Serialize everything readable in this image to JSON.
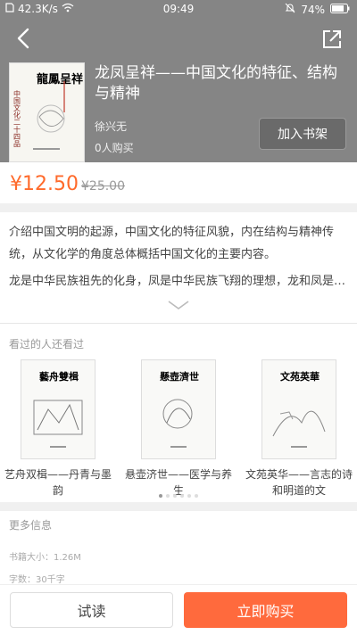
{
  "status_bar": {
    "speed": "42.3K/s",
    "time": "09:49",
    "battery": "74%"
  },
  "book": {
    "title": "龙凤呈祥——中国文化的特征、结构与精神",
    "author": "徐兴无",
    "buyers": "0人购买",
    "add_shelf_label": "加入书架",
    "price": "¥12.50",
    "original_price": "¥25.00",
    "cover_title": "龍鳳呈祥"
  },
  "description": {
    "line1": "介绍中国文明的起源，中国文化的特征风貌，内在结构与精神传统，从文化学的角度总体概括中国文化的主要内容。",
    "line2": "龙是中华民族祖先的化身，凤是中华民族飞翔的理想，龙和凤是中…"
  },
  "recommend": {
    "title": "看过的人还看过",
    "items": [
      {
        "title": "艺舟双楫——丹青与墨韵",
        "cover_text": "藝舟雙楫"
      },
      {
        "title": "悬壶济世——医学与养生",
        "cover_text": "懸壺濟世"
      },
      {
        "title": "文苑英华——言志的诗和明道的文",
        "cover_text": "文苑英華"
      }
    ]
  },
  "more_info": {
    "title": "更多信息",
    "size": "书籍大小：1.26M",
    "words": "字数：30千字"
  },
  "actions": {
    "try_read": "试读",
    "buy_now": "立即购买"
  },
  "colors": {
    "accent": "#ff6a3d",
    "price": "#ff6a2b",
    "header_bg": "#858585"
  }
}
